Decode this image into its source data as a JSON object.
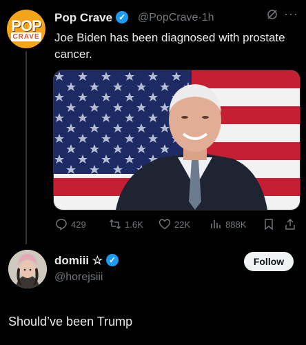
{
  "tweet": {
    "author_name": "Pop Crave",
    "author_handle": "@PopCrave",
    "time": "1h",
    "text": "Joe Biden has been diagnosed with prostate cancer.",
    "avatar_logo_top": "POP",
    "avatar_logo_bottom": "CRAVE",
    "icons": [
      "grok-icon",
      "more-icon"
    ],
    "stats": {
      "replies": "429",
      "reposts": "1.6K",
      "likes": "22K",
      "views": "888K"
    }
  },
  "reply": {
    "author_name": "domiii ☆",
    "author_handle": "@horejsiii",
    "text": "Should’ve been Trump",
    "follow_label": "Follow"
  },
  "colors": {
    "background": "#000000",
    "primary_text": "#e7e9ea",
    "secondary_text": "#71767b",
    "verified": "#1d9bf0",
    "follow_button": "#eff3f4"
  }
}
